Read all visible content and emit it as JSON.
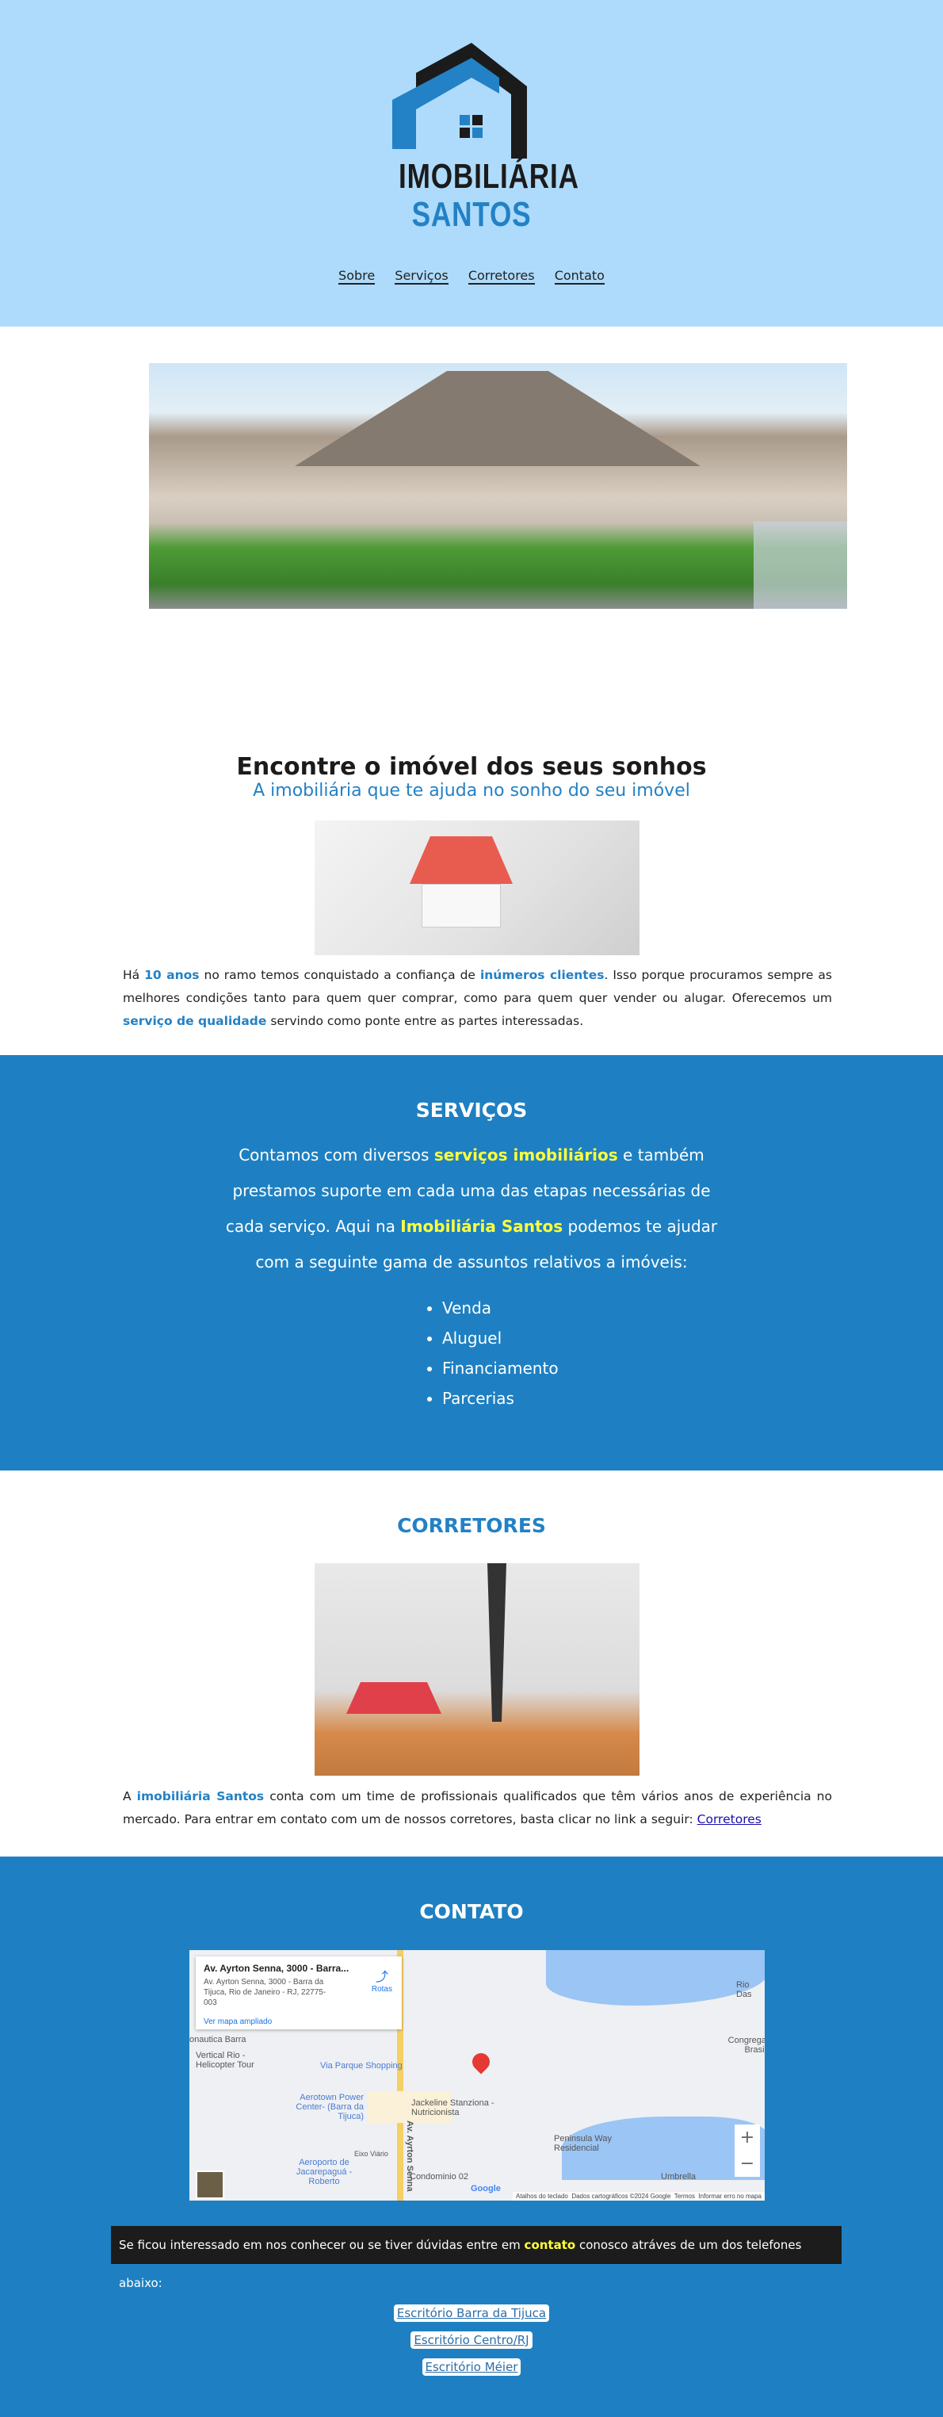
{
  "header": {
    "logo_line1": "IMOBILIÁRIA",
    "logo_line2": "SANTOS",
    "nav": [
      "Sobre",
      "Serviços",
      "Corretores",
      "Contato"
    ]
  },
  "hero": {
    "watermark": "IMOBILIÁRIA SANTOS"
  },
  "about": {
    "title": "Encontre o imóvel dos seus sonhos",
    "subtitle": "A imobiliária que te ajuda no sonho do seu imóvel",
    "p": [
      "Há ",
      "10 anos",
      " no ramo temos conquistado a confiança de ",
      "inúmeros clientes",
      ". Isso porque procuramos sempre as melhores condições tanto para quem quer comprar, como para quem quer vender ou alugar. Oferecemos um ",
      "serviço de qualidade",
      " servindo como ponte entre as partes interessadas."
    ]
  },
  "services": {
    "title": "SERVIÇOS",
    "p": [
      "Contamos com diversos ",
      "serviços imobiliários",
      " e também prestamos suporte em cada uma das etapas necessárias de cada serviço. Aqui na ",
      "Imobiliária Santos",
      " podemos te ajudar com a seguinte gama de assuntos relativos a imóveis:"
    ],
    "items": [
      "Venda",
      "Aluguel",
      "Financiamento",
      "Parcerias"
    ]
  },
  "brokers": {
    "title": "CORRETORES",
    "p": [
      "A ",
      "imobiliária Santos",
      " conta com um time de profissionais qualificados que têm vários anos de experiência no mercado. Para entrar em contato com um de nossos corretores, basta clicar no link a seguir: "
    ],
    "link": "Corretores"
  },
  "contact": {
    "title": "CONTATO",
    "map": {
      "place": "Av. Ayrton Senna, 3000 - Barra...",
      "address": "Av. Ayrton Senna, 3000 - Barra da Tijuca, Rio de Janeiro - RJ, 22775-003",
      "directions": "Rotas",
      "view_larger": "Ver mapa ampliado",
      "labels": [
        "Via Parque Shopping",
        "Aerotown Power Center- (Barra da Tijuca)",
        "Jackeline Stanziona - Nutricionista",
        "Peninsula Way Residencial",
        "Umbrella",
        "Condominio 02",
        "Aeroporto de Jacarepaguá - Roberto",
        "Vertical Rio - Helicopter Tour",
        "onautica Barra",
        "Av. Ayrton Senna",
        "Eixo Viário",
        "Rio Das",
        "Congrega Brasil"
      ],
      "footer": [
        "Atalhos do teclado",
        "Dados cartográficos ©2024 Google",
        "Termos",
        "Informar erro no mapa"
      ],
      "zoom_in": "+",
      "zoom_out": "−",
      "google": "Google"
    },
    "bar": [
      "Se ficou interessado em nos conhecer ou se tiver dúvidas entre em ",
      "contato",
      " conosco atráves de um dos telefones abaixo:"
    ],
    "offices": [
      "Escritório Barra da Tijuca",
      "Escritório Centro/RJ",
      "Escritório Méier"
    ]
  },
  "colors": {
    "header_bg": "#aedbfb",
    "brand_blue": "#2381c5",
    "section_blue": "#1e80c2",
    "highlight": "#ffff3c"
  }
}
